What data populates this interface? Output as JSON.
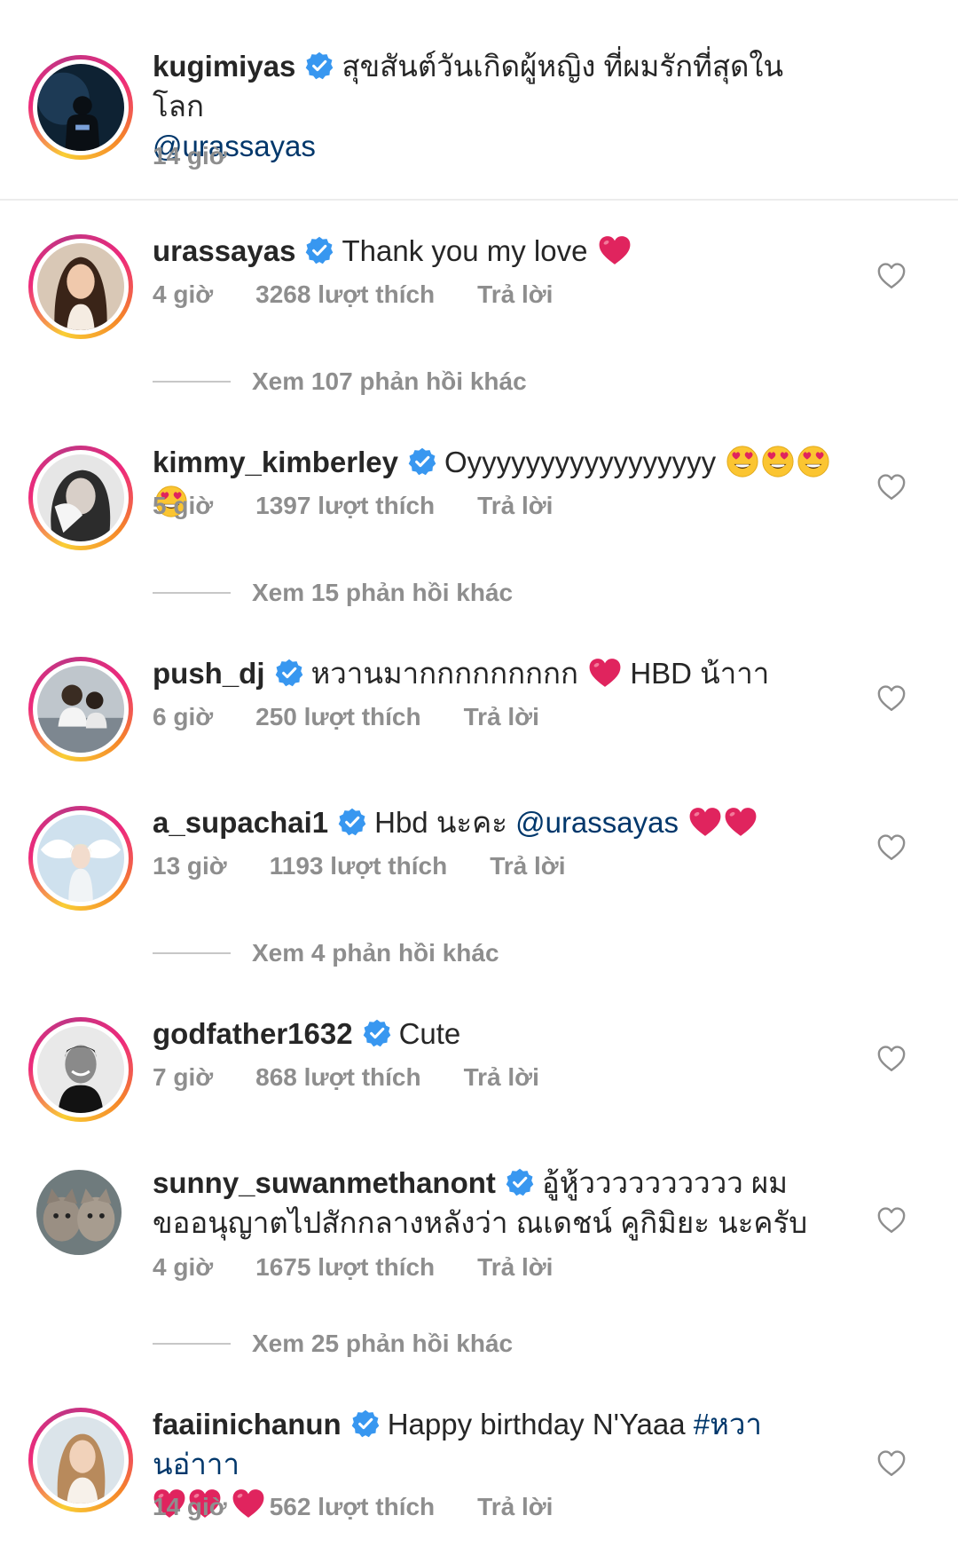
{
  "caption": {
    "username": "kugimiyas",
    "text": "สุขสันต์วันเกิดผู้หญิง ที่ผมรักที่สุดในโลก",
    "mention": "@urassayas",
    "time": "14 giờ"
  },
  "comments": [
    {
      "username": "urassayas",
      "text": "Thank you my love",
      "time": "4 giờ",
      "likes": "3268 lượt thích",
      "reply": "Trả lời",
      "more": "Xem 107 phản hồi khác"
    },
    {
      "username": "kimmy_kimberley",
      "text": "Oyyyyyyyyyyyyyyyyy",
      "time": "5 giờ",
      "likes": "1397 lượt thích",
      "reply": "Trả lời",
      "more": "Xem 15 phản hồi khác"
    },
    {
      "username": "push_dj",
      "text": "หวานมากกกกกกกกก",
      "text2": "HBD น้าาา",
      "time": "6 giờ",
      "likes": "250 lượt thích",
      "reply": "Trả lời"
    },
    {
      "username": "a_supachai1",
      "text": "Hbd นะคะ",
      "mention": "@urassayas",
      "time": "13 giờ",
      "likes": "1193 lượt thích",
      "reply": "Trả lời",
      "more": "Xem 4 phản hồi khác"
    },
    {
      "username": "godfather1632",
      "text": "Cute",
      "time": "7 giờ",
      "likes": "868 lượt thích",
      "reply": "Trả lời"
    },
    {
      "username": "sunny_suwanmethanont",
      "text": "อู้หู้วววววววววว ผมขออนุญาตไปสักกลางหลังว่า ณเดชน์ คูกิมิยะ นะครับ",
      "time": "4 giờ",
      "likes": "1675 lượt thích",
      "reply": "Trả lời",
      "more": "Xem 25 phản hồi khác"
    },
    {
      "username": "faaiinichanun",
      "text": "Happy birthday N'Yaaa",
      "hashtag": "#หวานอ่าาา",
      "time": "14 giờ",
      "likes": "562 lượt thích",
      "reply": "Trả lời"
    }
  ],
  "colors": {
    "verified": "#3897f0",
    "meta": "#8e8e8e",
    "link": "#00376b",
    "heart_emoji": "#e0245e"
  }
}
